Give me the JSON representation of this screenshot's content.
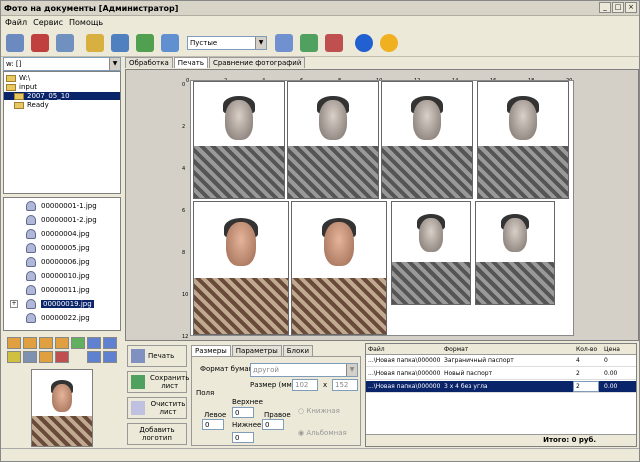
{
  "window": {
    "title": "Фото на документы [Администратор]"
  },
  "menu": [
    "Файл",
    "Сервис",
    "Помощь"
  ],
  "toolbar": {
    "combo_value": "Пустые"
  },
  "drive": {
    "value": "w: []"
  },
  "folders": [
    "W:\\",
    "input",
    "2007_05_10",
    "Ready"
  ],
  "files": [
    "00000001-1.jpg",
    "00000001-2.jpg",
    "00000004.jpg",
    "00000005.jpg",
    "00000006.jpg",
    "00000010.jpg",
    "00000011.jpg",
    "00000019.jpg",
    "00000022.jpg"
  ],
  "tabs": [
    "Обработка",
    "Печать",
    "Сравнение фотографий"
  ],
  "ruler": {
    "h": [
      "0",
      "2",
      "4",
      "6",
      "8",
      "10",
      "12",
      "14",
      "16",
      "18",
      "20"
    ],
    "v": [
      "0",
      "2",
      "4",
      "6",
      "8",
      "10",
      "12"
    ]
  },
  "actions": {
    "print": "Печать",
    "save": "Сохранить лист",
    "clear": "Очистить лист",
    "logo": "Добавить логотип"
  },
  "settings": {
    "tabs": [
      "Размеры",
      "Параметры",
      "Блоки"
    ],
    "paper_label": "Формат бумаги",
    "paper_value": "другой",
    "size_label": "Размер (мм):",
    "w": "102",
    "x": "x",
    "h": "152",
    "margins": "Поля",
    "top_l": "Верхнее",
    "top_v": "0",
    "left_l": "Левое",
    "left_v": "0",
    "right_l": "Правое",
    "right_v": "0",
    "bottom_l": "Нижнее",
    "bottom_v": "0",
    "portrait": "Книжная",
    "landscape": "Альбомная"
  },
  "table": {
    "headers": [
      "Файл",
      "Формат",
      "Кол-во",
      "Цена"
    ],
    "rows": [
      {
        "file": "...\\Новая папка\\00000019",
        "format": "Заграничный паспорт",
        "qty": "4",
        "price": "0"
      },
      {
        "file": "...\\Новая папка\\00000019",
        "format": "Новый паспорт",
        "qty": "2",
        "price": "0.00"
      },
      {
        "file": "...\\Новая папка\\00000019",
        "format": "3 x 4 без угла",
        "qty": "2",
        "price": "0.00"
      }
    ],
    "total": "Итого: 0 руб."
  }
}
